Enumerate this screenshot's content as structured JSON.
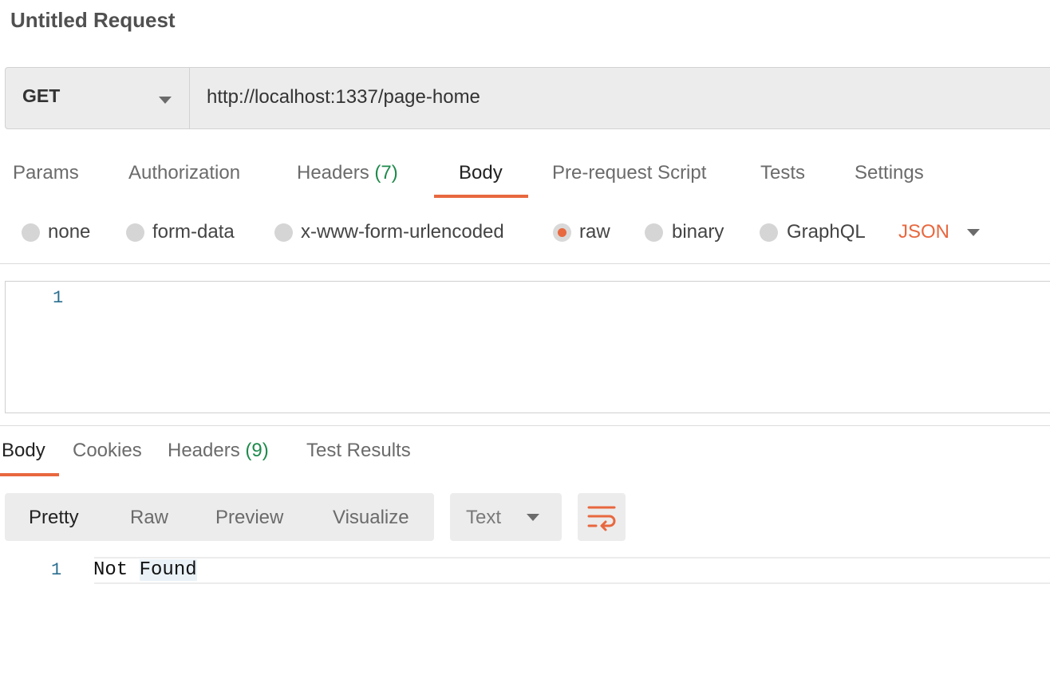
{
  "request": {
    "title": "Untitled Request",
    "method": "GET",
    "url": "http://localhost:1337/page-home"
  },
  "request_tabs": [
    {
      "label": "Params"
    },
    {
      "label": "Authorization"
    },
    {
      "label": "Headers",
      "count": "(7)"
    },
    {
      "label": "Body",
      "active": true
    },
    {
      "label": "Pre-request Script"
    },
    {
      "label": "Tests"
    },
    {
      "label": "Settings"
    }
  ],
  "body_types": [
    {
      "label": "none",
      "checked": false
    },
    {
      "label": "form-data",
      "checked": false
    },
    {
      "label": "x-www-form-urlencoded",
      "checked": false
    },
    {
      "label": "raw",
      "checked": true
    },
    {
      "label": "binary",
      "checked": false
    },
    {
      "label": "GraphQL",
      "checked": false
    }
  ],
  "raw_format": "JSON",
  "request_editor": {
    "line_numbers": [
      "1"
    ]
  },
  "response_tabs": [
    {
      "label": "Body",
      "active": true
    },
    {
      "label": "Cookies"
    },
    {
      "label": "Headers",
      "count": "(9)"
    },
    {
      "label": "Test Results"
    }
  ],
  "response_view_modes": [
    {
      "label": "Pretty",
      "active": true
    },
    {
      "label": "Raw"
    },
    {
      "label": "Preview"
    },
    {
      "label": "Visualize"
    }
  ],
  "response_format": "Text",
  "response_body": {
    "line_number": "1",
    "word1": "Not",
    "word2": "Found"
  },
  "colors": {
    "accent": "#e8683f",
    "count_green": "#1f8a4c",
    "line_number_blue": "#2a6e8f"
  },
  "icons": {
    "method_dropdown": "chevron-down-icon",
    "format_dropdown": "chevron-down-icon",
    "wrap": "wrap-lines-icon"
  }
}
